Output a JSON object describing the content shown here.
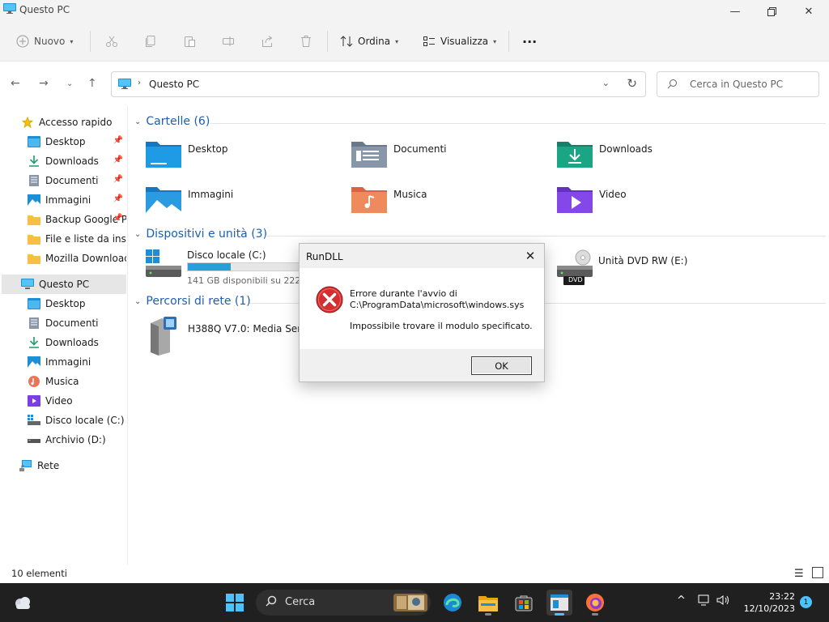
{
  "window": {
    "title": "Questo PC"
  },
  "commandbar": {
    "new_label": "Nuovo",
    "sort_label": "Ordina",
    "view_label": "Visualizza",
    "more_label": "···"
  },
  "address": {
    "path": "Questo PC",
    "search_placeholder": "Cerca in Questo PC"
  },
  "sidebar": {
    "items": [
      {
        "label": "Accesso rapido",
        "icon": "star-icon"
      },
      {
        "label": "Desktop",
        "icon": "desktop-icon",
        "pinned": true
      },
      {
        "label": "Downloads",
        "icon": "download-icon",
        "pinned": true
      },
      {
        "label": "Documenti",
        "icon": "document-icon",
        "pinned": true
      },
      {
        "label": "Immagini",
        "icon": "image-icon",
        "pinned": true
      },
      {
        "label": "Backup Google Pho",
        "icon": "folder-icon",
        "pinned": true
      },
      {
        "label": "File e liste da inserir",
        "icon": "folder-icon"
      },
      {
        "label": "Mozilla Download",
        "icon": "folder-icon"
      },
      {
        "label": "Questo PC",
        "icon": "pc-icon",
        "selected": true
      },
      {
        "label": "Desktop",
        "icon": "desktop-icon"
      },
      {
        "label": "Documenti",
        "icon": "document-icon"
      },
      {
        "label": "Downloads",
        "icon": "download-icon"
      },
      {
        "label": "Immagini",
        "icon": "image-icon"
      },
      {
        "label": "Musica",
        "icon": "music-icon"
      },
      {
        "label": "Video",
        "icon": "video-icon"
      },
      {
        "label": "Disco locale (C:)",
        "icon": "drive-icon"
      },
      {
        "label": "Archivio (D:)",
        "icon": "drive-icon"
      },
      {
        "label": "Rete",
        "icon": "network-icon"
      }
    ]
  },
  "main": {
    "folders_header": "Cartelle (6)",
    "folders": [
      "Desktop",
      "Documenti",
      "Downloads",
      "Immagini",
      "Musica",
      "Video"
    ],
    "devices_header": "Dispositivi e unità (3)",
    "drive_c": {
      "label": "Disco locale (C:)",
      "sub": "141 GB disponibili su 222 GB",
      "used_fraction": 0.36
    },
    "drive_dvd": {
      "label": "Unità DVD RW (E:)",
      "badge": "DVD"
    },
    "network_header": "Percorsi di rete (1)",
    "network_item": "H388Q V7.0: Media Server:"
  },
  "status": {
    "count": "10 elementi"
  },
  "dialog": {
    "title": "RunDLL",
    "line1": "Errore durante l'avvio di",
    "line2": "C:\\ProgramData\\microsoft\\windows.sys",
    "line3": "Impossibile trovare il modulo specificato.",
    "ok_label": "OK"
  },
  "taskbar": {
    "search_label": "Cerca",
    "time": "23:22",
    "date": "12/10/2023",
    "notifications": "1"
  },
  "colors": {
    "accent": "#0078d4",
    "error": "#d32f2f",
    "taskbar": "#202020"
  }
}
